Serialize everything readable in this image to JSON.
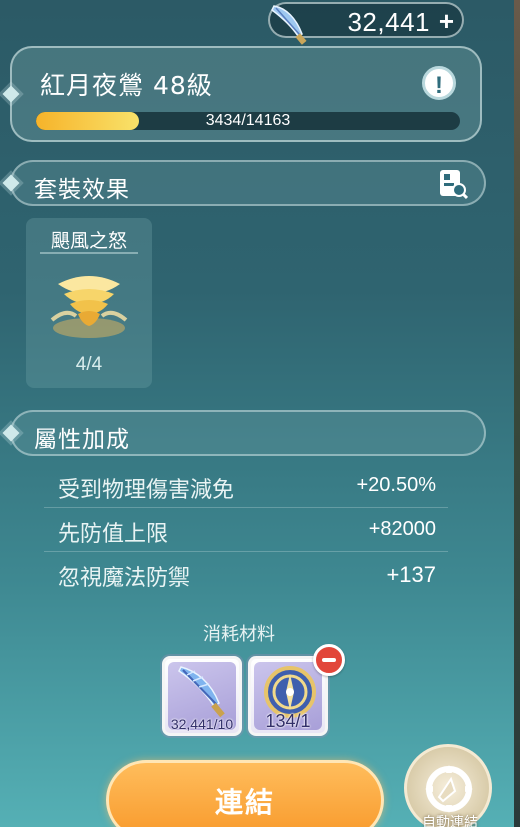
{
  "currency": {
    "amount": "32,441",
    "add_label": "+",
    "icon": "feather-icon"
  },
  "equipment": {
    "title": "紅月夜鶯 48級",
    "info_label": "!",
    "xp_text": "3434/14163",
    "xp_progress": 0.2425
  },
  "set_effect": {
    "header": "套裝效果",
    "name": "颶風之怒",
    "count": "4/4",
    "icon": "tornado-icon"
  },
  "attributes": {
    "header": "屬性加成",
    "rows": [
      {
        "name": "受到物理傷害減免",
        "value": "+20.50%"
      },
      {
        "name": "先防值上限",
        "value": "+82000"
      },
      {
        "name": "忽視魔法防禦",
        "value": "+137"
      }
    ]
  },
  "materials": {
    "label": "消耗材料",
    "items": [
      {
        "icon": "feather-icon",
        "qty": "32,441/10"
      },
      {
        "icon": "compass-icon",
        "qty": "134/1"
      }
    ]
  },
  "actions": {
    "connect": "連結",
    "auto": "自動連結"
  }
}
